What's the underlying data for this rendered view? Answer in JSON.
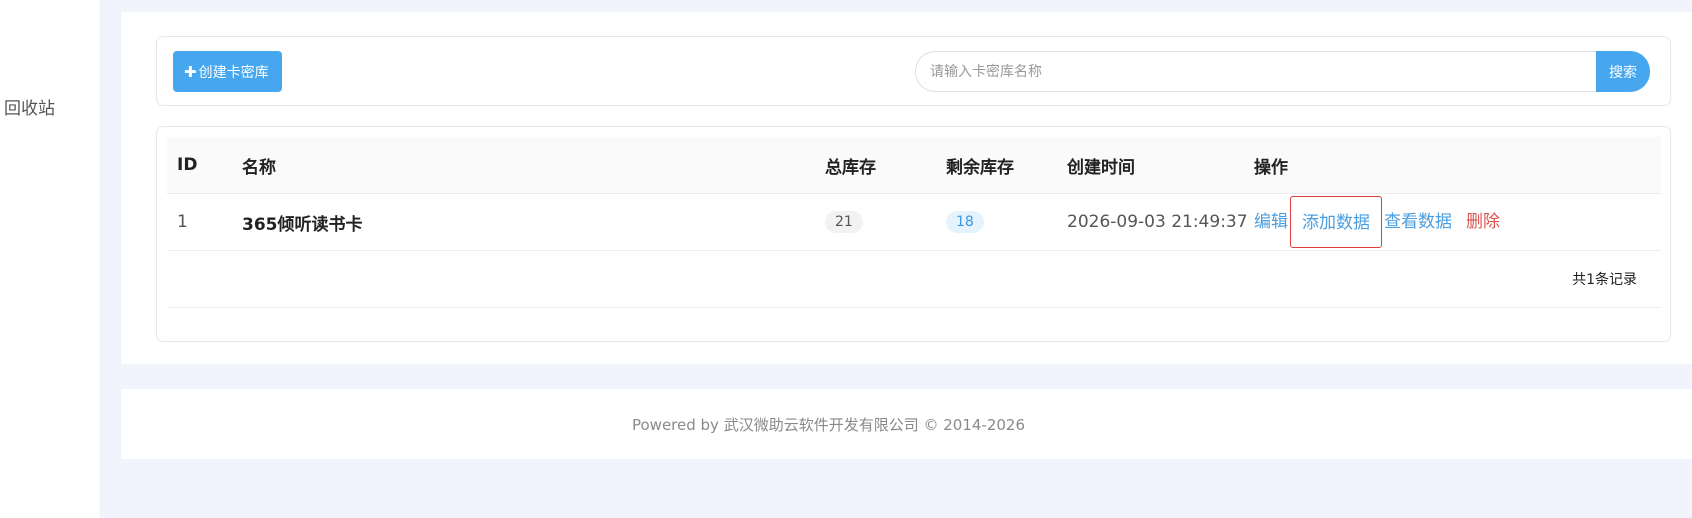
{
  "sidebar": {
    "items": [
      {
        "label": "回收站"
      }
    ]
  },
  "toolbar": {
    "create_label": "创建卡密库",
    "create_icon": "plus-icon",
    "search_placeholder": "请输入卡密库名称",
    "search_value": "",
    "search_label": "搜索"
  },
  "table": {
    "headers": {
      "id": "ID",
      "name": "名称",
      "total": "总库存",
      "remain": "剩余库存",
      "created": "创建时间",
      "actions": "操作"
    },
    "rows": [
      {
        "id": "1",
        "name": "365倾听读书卡",
        "total": "21",
        "remain": "18",
        "created": "2026-09-03 21:49:37",
        "actions": {
          "edit": "编辑",
          "add": "添加数据",
          "view": "查看数据",
          "delete": "删除"
        }
      }
    ],
    "summary": "共1条记录"
  },
  "footer": {
    "text": "Powered by 武汉微助云软件开发有限公司 © 2014-2026"
  },
  "colors": {
    "primary": "#46a6ee",
    "link": "#4a9ee0",
    "danger": "#d9534f",
    "highlight_border": "#e03c3c",
    "page_bg": "#f1f4fd"
  }
}
